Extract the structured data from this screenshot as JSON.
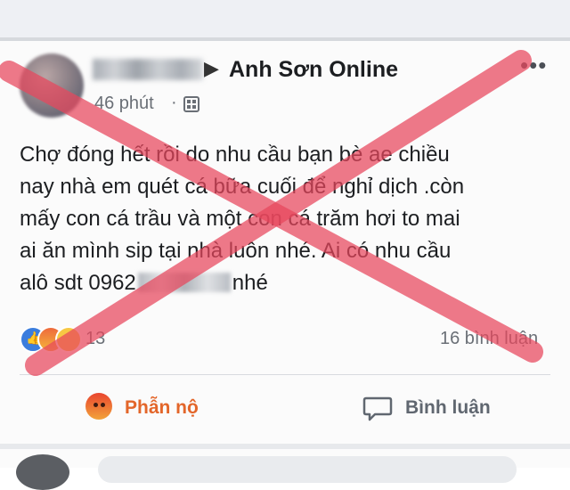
{
  "post": {
    "group_name": "Anh Sơn Online",
    "time": "46 phút",
    "text_lines": [
      "Chợ đóng hết rồi do nhu cầu bạn bè ae  chiều",
      "nay nhà em quét cá bữa cuối để nghỉ dịch .còn",
      "mấy con cá trầu và một con cá trăm hơi to mai",
      "ai ăn  mình sip tại nhà luôn nhé. Ai có nhu cầu"
    ],
    "last_line_start": "alô sdt 0962",
    "last_line_end": "nhé",
    "reaction_count": "13",
    "comments_count": "16 bình luận"
  },
  "actions": {
    "reaction_label": "Phẫn nộ",
    "comment_label": "Bình luận"
  },
  "icons": [
    "arrow-right-icon",
    "more-icon",
    "group-icon",
    "like-icon",
    "angry-icon",
    "wow-icon",
    "comment-icon"
  ],
  "colors": {
    "x_mark": "#e8475d",
    "angry_text": "#e3662a"
  }
}
